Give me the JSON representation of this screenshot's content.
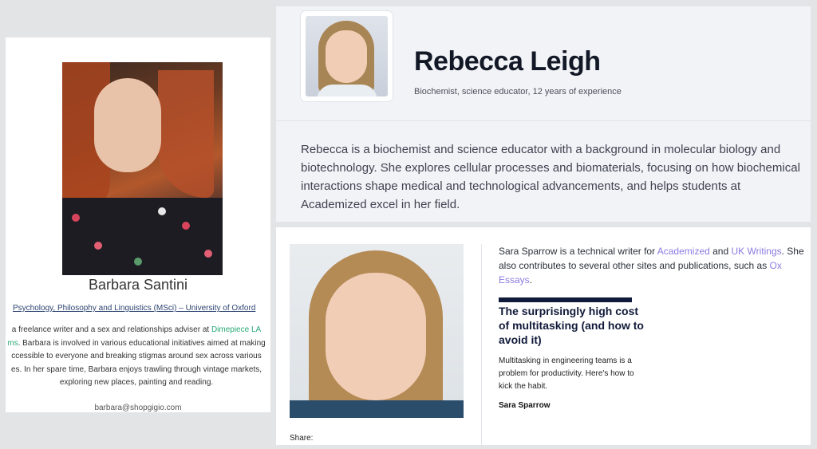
{
  "barbara": {
    "name": "Barbara Santini",
    "degree": "Psychology, Philosophy and Linguistics (MSci) – University of Oxford",
    "bio_line1_pre": "a freelance writer and a sex and relationships adviser at ",
    "bio_line1_link": "Dimepiece LA",
    "bio_line2_link": "ms",
    "bio_line2_post": ". Barbara is involved in various educational initiatives aimed at making",
    "bio_line3": "ccessible to everyone and breaking stigmas around sex across various",
    "bio_line4": "es. In her spare time, Barbara enjoys trawling through vintage markets,",
    "bio_line5": "exploring new places, painting and reading.",
    "email": "barbara@shopgigio.com"
  },
  "rebecca": {
    "name": "Rebecca Leigh",
    "subtitle": "Biochemist, science educator, 12 years of experience",
    "bio": "Rebecca is a biochemist and science educator with a background in molecular biology and biotechnology. She explores cellular processes and biomaterials, focusing on how biochemical interactions shape medical and technological advancements, and helps students at Academized excel in her field."
  },
  "sara": {
    "intro_pre": "Sara Sparrow is a technical writer for ",
    "link_academized": "Academized",
    "intro_and": " and ",
    "link_ukwritings": "UK Writings",
    "intro_mid": ". She also contributes to several other sites and publications, such as ",
    "link_oxessays": "Ox Essays",
    "intro_end": ".",
    "headline": "The surprisingly high cost of multitasking (and how to avoid it)",
    "teaser": "Multitasking in engineering teams is a problem for productivity. Here's how to kick the habit.",
    "author": "Sara Sparrow",
    "share_label": "Share:"
  },
  "colors": {
    "link_green": "#2aa878",
    "link_purple": "#8a7ce0",
    "navy": "#111a3a",
    "background": "#e3e4e6"
  }
}
